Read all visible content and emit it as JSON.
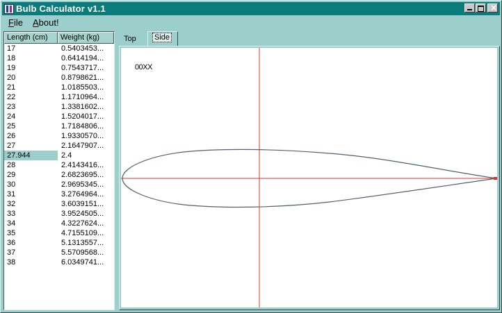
{
  "window": {
    "title": "Bulb Calculator v1.1",
    "close_glyph": "×"
  },
  "menu": {
    "file": {
      "mnemonic": "F",
      "rest": "ile"
    },
    "about": {
      "mnemonic": "A",
      "rest": "bout!"
    }
  },
  "table": {
    "headers": [
      "Length (cm)",
      "Weight (kg)"
    ],
    "selected_index": 11,
    "rows": [
      [
        "17",
        "0.5403453..."
      ],
      [
        "18",
        "0.6414194..."
      ],
      [
        "19",
        "0.7543717..."
      ],
      [
        "20",
        "0.8798621..."
      ],
      [
        "21",
        "1.0185503..."
      ],
      [
        "22",
        "1.1710964..."
      ],
      [
        "23",
        "1.3381602..."
      ],
      [
        "24",
        "1.5204017..."
      ],
      [
        "25",
        "1.7184806..."
      ],
      [
        "26",
        "1.9330570..."
      ],
      [
        "27",
        "2.1647907..."
      ],
      [
        "27.944",
        "2.4"
      ],
      [
        "28",
        "2.4143416..."
      ],
      [
        "29",
        "2.6823695..."
      ],
      [
        "30",
        "2.9695345..."
      ],
      [
        "31",
        "3.2764964..."
      ],
      [
        "32",
        "3.6039151..."
      ],
      [
        "33",
        "3.9524505..."
      ],
      [
        "34",
        "4.3227624..."
      ],
      [
        "35",
        "4.7155109..."
      ],
      [
        "36",
        "5.1313557..."
      ],
      [
        "37",
        "5.5709568..."
      ],
      [
        "38",
        "6.0349741..."
      ]
    ]
  },
  "tabs": {
    "top": "Top",
    "side": "Side",
    "active": "side"
  },
  "canvas": {
    "profile_label": "00XX",
    "axis_color": "#e03030",
    "outline_color": "#506070"
  }
}
